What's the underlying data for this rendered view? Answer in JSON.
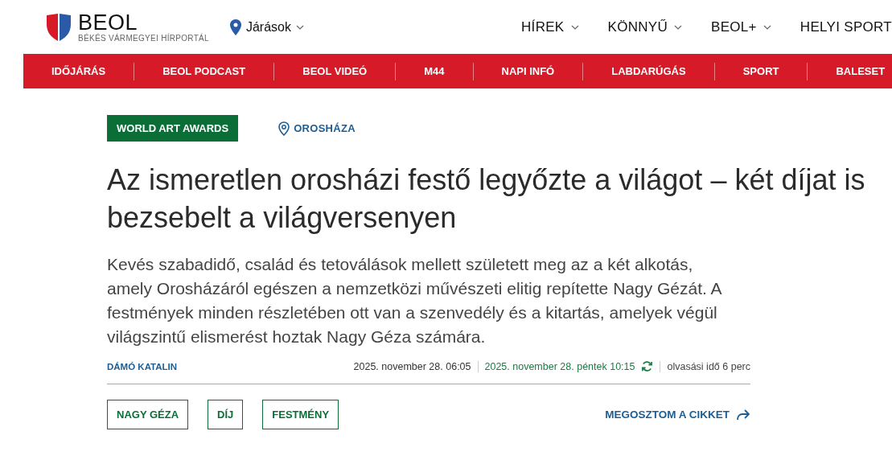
{
  "logo": {
    "name": "BEOL",
    "tagline": "BÉKÉS VÁRMEGYEI HÍRPORTÁL"
  },
  "location_menu": {
    "label": "Járások"
  },
  "main_nav": [
    {
      "label": "HÍREK",
      "dropdown": true
    },
    {
      "label": "KÖNNYŰ",
      "dropdown": true
    },
    {
      "label": "BEOL+",
      "dropdown": true
    },
    {
      "label": "HELYI SPORT",
      "dropdown": false
    }
  ],
  "category_nav": [
    "IDŐJÁRÁS",
    "BEOL PODCAST",
    "BEOL VIDEÓ",
    "M44",
    "NAPI INFÓ",
    "LABDARÚGÁS",
    "SPORT",
    "BALESET"
  ],
  "article": {
    "category": "WORLD ART AWARDS",
    "location": "OROSHÁZA",
    "title": "Az ismeretlen orosházi festő legyőzte a világot – két díjat is bezsebelt a világversenyen",
    "lead": "Kevés szabadidő, család és tetoválások mellett született meg az a két alkotás, amely Orosházáról egészen a nemzetközi művészeti elitig repítette Nagy Gézát. A festmények minden részletében ott van a szenvedély és a kitartás, amelyek végül világszintű elismerést hoztak Nagy Géza számára.",
    "author": "DÁMÓ KATALIN",
    "published": "2025. november 28. 06:05",
    "updated": "2025. november 28. péntek 10:15",
    "reading_time": "olvasási idő 6 perc",
    "tags": [
      "NAGY GÉZA",
      "DÍJ",
      "FESTMÉNY"
    ],
    "share": "MEGOSZTOM A CIKKET"
  }
}
